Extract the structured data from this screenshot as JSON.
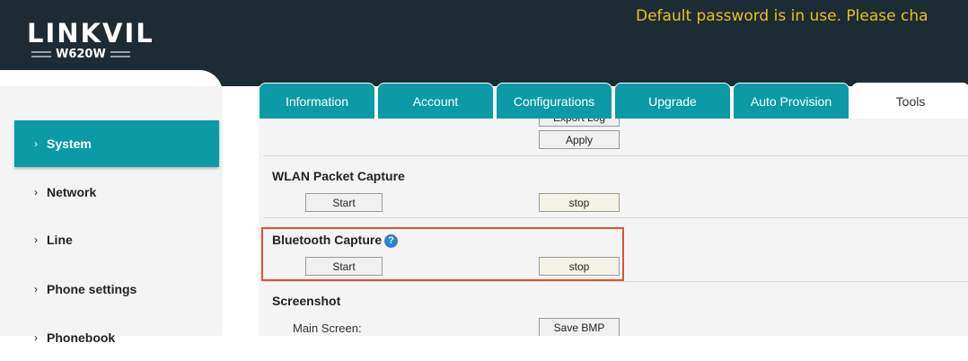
{
  "header": {
    "logo": "LINKVIL",
    "model": "W620W",
    "warning": "Default password is in use. Please cha"
  },
  "tabs": [
    {
      "label": "Information",
      "active": false
    },
    {
      "label": "Account",
      "active": false
    },
    {
      "label": "Configurations",
      "active": false
    },
    {
      "label": "Upgrade",
      "active": false
    },
    {
      "label": "Auto Provision",
      "active": false
    },
    {
      "label": "Tools",
      "active": true
    }
  ],
  "sidebar": {
    "items": [
      {
        "label": "System",
        "active": true
      },
      {
        "label": "Network",
        "active": false
      },
      {
        "label": "Line",
        "active": false
      },
      {
        "label": "Phone settings",
        "active": false
      },
      {
        "label": "Phonebook",
        "active": false
      }
    ]
  },
  "content": {
    "export_log_button": "Export Log",
    "apply_button": "Apply",
    "wlan": {
      "title": "WLAN Packet Capture",
      "start": "Start",
      "stop": "stop"
    },
    "bluetooth": {
      "title": "Bluetooth Capture",
      "help": "?",
      "start": "Start",
      "stop": "stop"
    },
    "screenshot": {
      "title": "Screenshot",
      "main_label": "Main Screen:",
      "save_button": "Save BMP"
    }
  },
  "colors": {
    "accent": "#0b9aa6",
    "header_bg": "#1d2b34",
    "warning": "#e8c21a",
    "highlight": "#e05030"
  }
}
